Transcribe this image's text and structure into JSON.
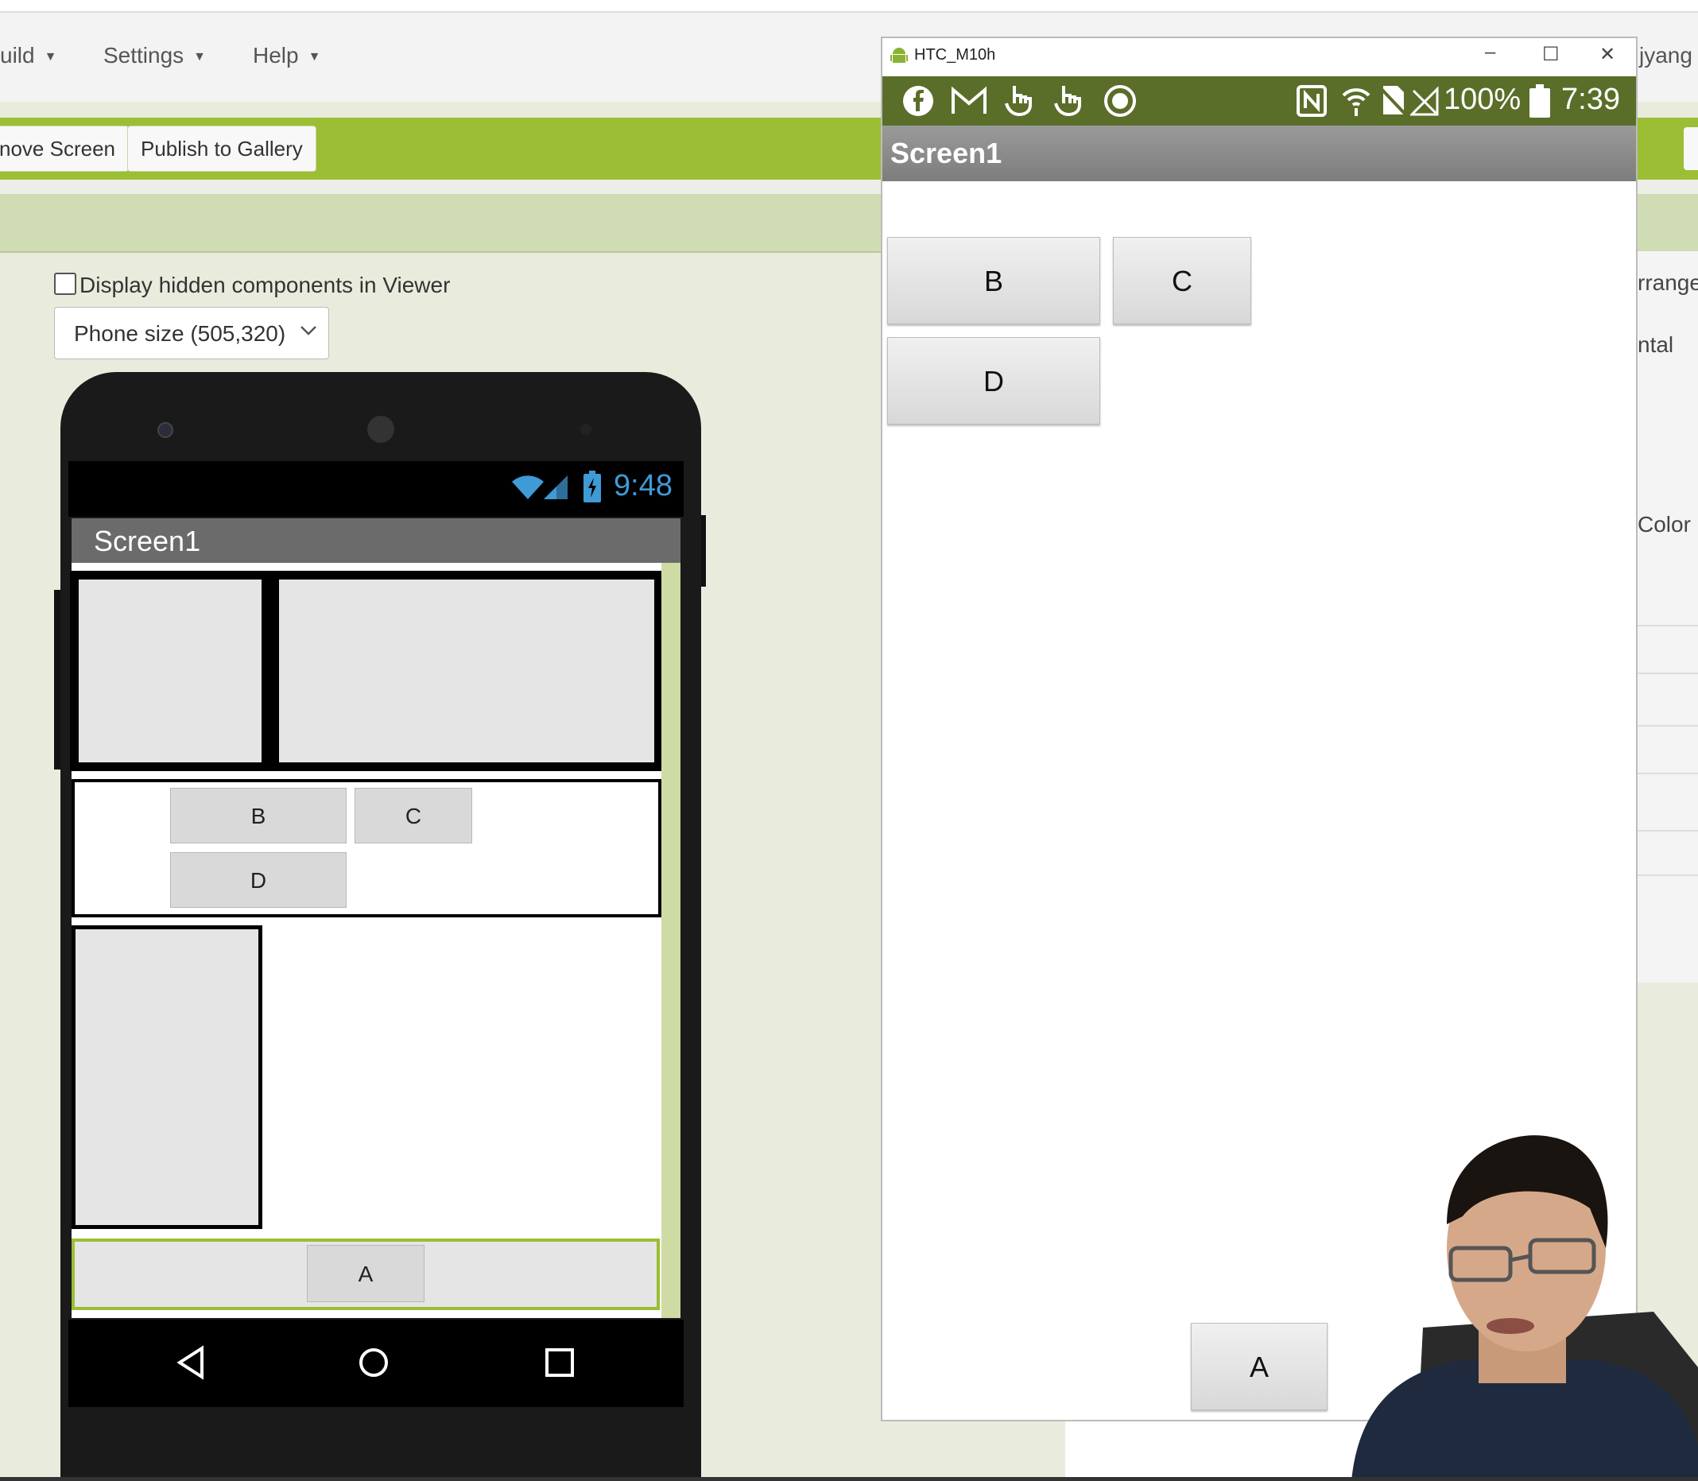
{
  "menubar": {
    "items": [
      {
        "label": "uild",
        "caret": "▼"
      },
      {
        "label": "Settings",
        "caret": "▼"
      },
      {
        "label": "Help",
        "caret": "▼"
      }
    ],
    "user_partial": "jyang"
  },
  "toolbar": {
    "remove_screen_label": "nove Screen",
    "publish_label": "Publish to Gallery"
  },
  "viewer": {
    "hidden_checkbox_label": "Display hidden components in Viewer",
    "phone_size_value": "Phone size (505,320)"
  },
  "mock_phone": {
    "time": "9:48",
    "screen_title": "Screen1",
    "buttons": {
      "b": "B",
      "c": "C",
      "d": "D",
      "a": "A"
    }
  },
  "emulator": {
    "window_title": "HTC_M10h",
    "battery_pct": "100%",
    "time": "7:39",
    "screen_title": "Screen1",
    "buttons": {
      "b": "B",
      "c": "C",
      "d": "D",
      "a": "A"
    },
    "controls": {
      "minimize": "–",
      "maximize": "☐",
      "close": "✕"
    }
  },
  "properties_panel": {
    "partial_labels": [
      "rrange",
      "ntal",
      "Color"
    ]
  },
  "colors": {
    "app_inventor_green": "#9bbe35",
    "emulator_status": "#5a6e2a",
    "phone_time": "#3f9ad6"
  }
}
